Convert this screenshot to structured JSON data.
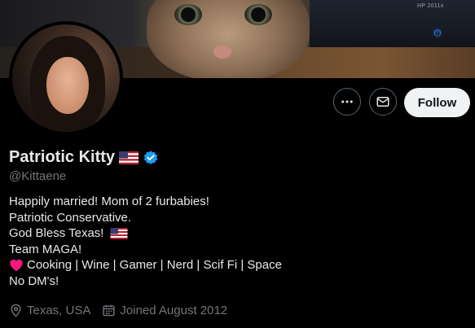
{
  "banner": {
    "monitor_model": "HP 2011x",
    "power_icon": "power-icon"
  },
  "actions": {
    "more_icon": "more-horizontal-icon",
    "message_icon": "envelope-icon",
    "follow_label": "Follow"
  },
  "profile": {
    "display_name": "Patriotic Kitty",
    "name_flag_icon": "us-flag-icon",
    "verified_icon": "verified-badge-icon",
    "verified_color": "#1d9bf0",
    "handle": "@Kittaene",
    "bio_lines": [
      "Happily married!  Mom of 2 furbabies!",
      "Patriotic Conservative.",
      "God Bless Texas!",
      "Team MAGA!",
      "Cooking | Wine | Gamer | Nerd | Scif Fi | Space",
      "No DM's!"
    ],
    "location": "Texas, USA",
    "joined": "Joined August 2012"
  },
  "colors": {
    "background": "#000000",
    "text_primary": "#e7e9ea",
    "text_secondary": "#71767b",
    "follow_bg": "#eff3f4",
    "heart": "#f91880"
  }
}
